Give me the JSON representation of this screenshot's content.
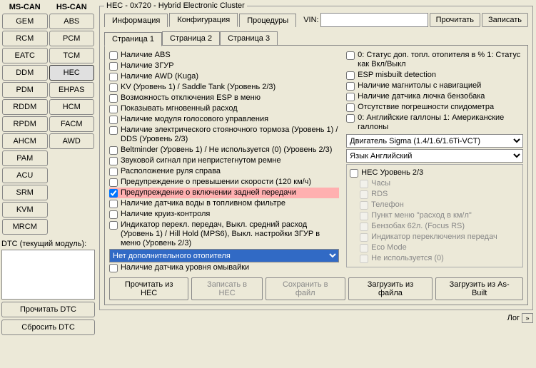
{
  "left": {
    "colHeaders": [
      "MS-CAN",
      "HS-CAN"
    ],
    "msCan": [
      "GEM",
      "RCM",
      "EATC",
      "DDM",
      "PDM",
      "RDDM",
      "RPDM",
      "AHCM",
      "PAM",
      "ACU",
      "SRM",
      "KVM",
      "MRCM"
    ],
    "hsCan": [
      "ABS",
      "PCM",
      "TCM",
      "HEC",
      "EHPAS",
      "HCM",
      "FACM",
      "AWD"
    ],
    "selected": "HEC",
    "dtcLabel": "DTC (текущий модуль):",
    "readDtc": "Прочитать DTC",
    "resetDtc": "Сбросить DTC"
  },
  "header": {
    "legend": "HEC - 0x720 - Hybrid Electronic Cluster",
    "tabs": [
      "Информация",
      "Конфигурация",
      "Процедуры"
    ],
    "activeTab": 1,
    "vinLabel": "VIN:",
    "vinValue": "",
    "readBtn": "Прочитать",
    "writeBtn": "Записать"
  },
  "pages": {
    "tabs": [
      "Страница 1",
      "Страница 2",
      "Страница 3"
    ],
    "active": 0
  },
  "configLeft": {
    "items": [
      {
        "label": "Наличие ABS",
        "checked": false
      },
      {
        "label": "Наличие ЗГУР",
        "checked": false
      },
      {
        "label": "Наличие AWD (Kuga)",
        "checked": false
      },
      {
        "label": "KV (Уровень 1) / Saddle Tank (Уровень 2/3)",
        "checked": false
      },
      {
        "label": "Возможность отключения ESP в меню",
        "checked": false
      },
      {
        "label": "Показывать мгновенный расход",
        "checked": false
      },
      {
        "label": "Наличие модуля голосового управления",
        "checked": false
      },
      {
        "label": "Наличие электрического стояночного тормоза (Уровень 1) / DDS (Уровень 2/3)",
        "checked": false
      },
      {
        "label": "Beltminder (Уровень 1) / Не используется (0) (Уровень 2/3)",
        "checked": false
      },
      {
        "label": "Звуковой сигнал при непристегнутом ремне",
        "checked": false
      },
      {
        "label": "Расположение руля справа",
        "checked": false
      },
      {
        "label": "Предупреждение о превышении скорости (120 км/ч)",
        "checked": false
      },
      {
        "label": "Предупреждение о включении задней передачи",
        "checked": true,
        "hl": true
      },
      {
        "label": "Наличие датчика воды в топливном фильтре",
        "checked": false
      },
      {
        "label": "Наличие круиз-контроля",
        "checked": false
      },
      {
        "label": "Индикатор перекл. передач, Выкл. средний расход (Уровень 1) / Hill Hold (MPS6), Выкл. настройки ЗГУР в меню     (Уровень 2/3)",
        "checked": false
      }
    ],
    "combo1": "Нет дополнительного отопителя",
    "lastItem": {
      "label": "Наличие датчика уровня омывайки",
      "checked": false
    }
  },
  "configRight": {
    "items": [
      {
        "label": "0: Статус доп. топл. отопителя в %  1: Статус как Вкл/Выкл",
        "checked": false
      },
      {
        "label": "ESP misbuilt detection",
        "checked": false
      },
      {
        "label": "Наличие магнитолы с навигацией",
        "checked": false
      },
      {
        "label": "Наличие датчика лючка бензобака",
        "checked": false
      },
      {
        "label": "Отсутствие погрешности спидометра",
        "checked": false
      },
      {
        "label": "0: Английские галлоны 1: Американские галлоны",
        "checked": false
      }
    ],
    "combo1": "Двигатель Sigma (1.4/1.6/1.6Ti-VCT)",
    "combo2": "Язык Английский",
    "subGroup": {
      "header": {
        "label": "HEC Уровень 2/3",
        "checked": false
      },
      "items": [
        {
          "label": "Часы"
        },
        {
          "label": "RDS"
        },
        {
          "label": "Телефон"
        },
        {
          "label": "Пункт меню \"расход в км/л\""
        },
        {
          "label": "Бензобак 62л. (Focus RS)"
        },
        {
          "label": "Индикатор переключения передач"
        },
        {
          "label": "Eco Mode"
        },
        {
          "label": "Не используется (0)"
        }
      ]
    }
  },
  "bottomBtns": {
    "readHec": "Прочитать из HEC",
    "writeHec": "Записать в HEC",
    "saveFile": "Сохранить в файл",
    "loadFile": "Загрузить из файла",
    "loadAsBuilt": "Загрузить из As-Built"
  },
  "log": {
    "label": "Лог",
    "expand": "»"
  }
}
